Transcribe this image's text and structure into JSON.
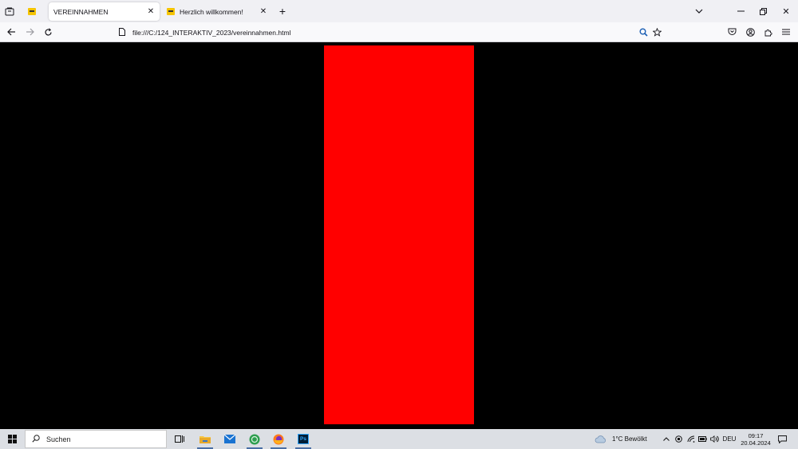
{
  "browser": {
    "tabs": [
      {
        "label": "VEREINNAHMEN",
        "active": true
      },
      {
        "label": "Herzlich willkommen!",
        "active": false
      }
    ],
    "url": "file:///C:/124_INTERAKTIV_2023/vereinnahmen.html"
  },
  "taskbar": {
    "search_label": "Suchen",
    "weather": "1°C  Bewölkt",
    "language": "DEU",
    "time": "09:17",
    "date": "20.04.2024",
    "ps_label": "Ps"
  },
  "colors": {
    "page_background": "#000000",
    "red_block": "#ff0000"
  }
}
